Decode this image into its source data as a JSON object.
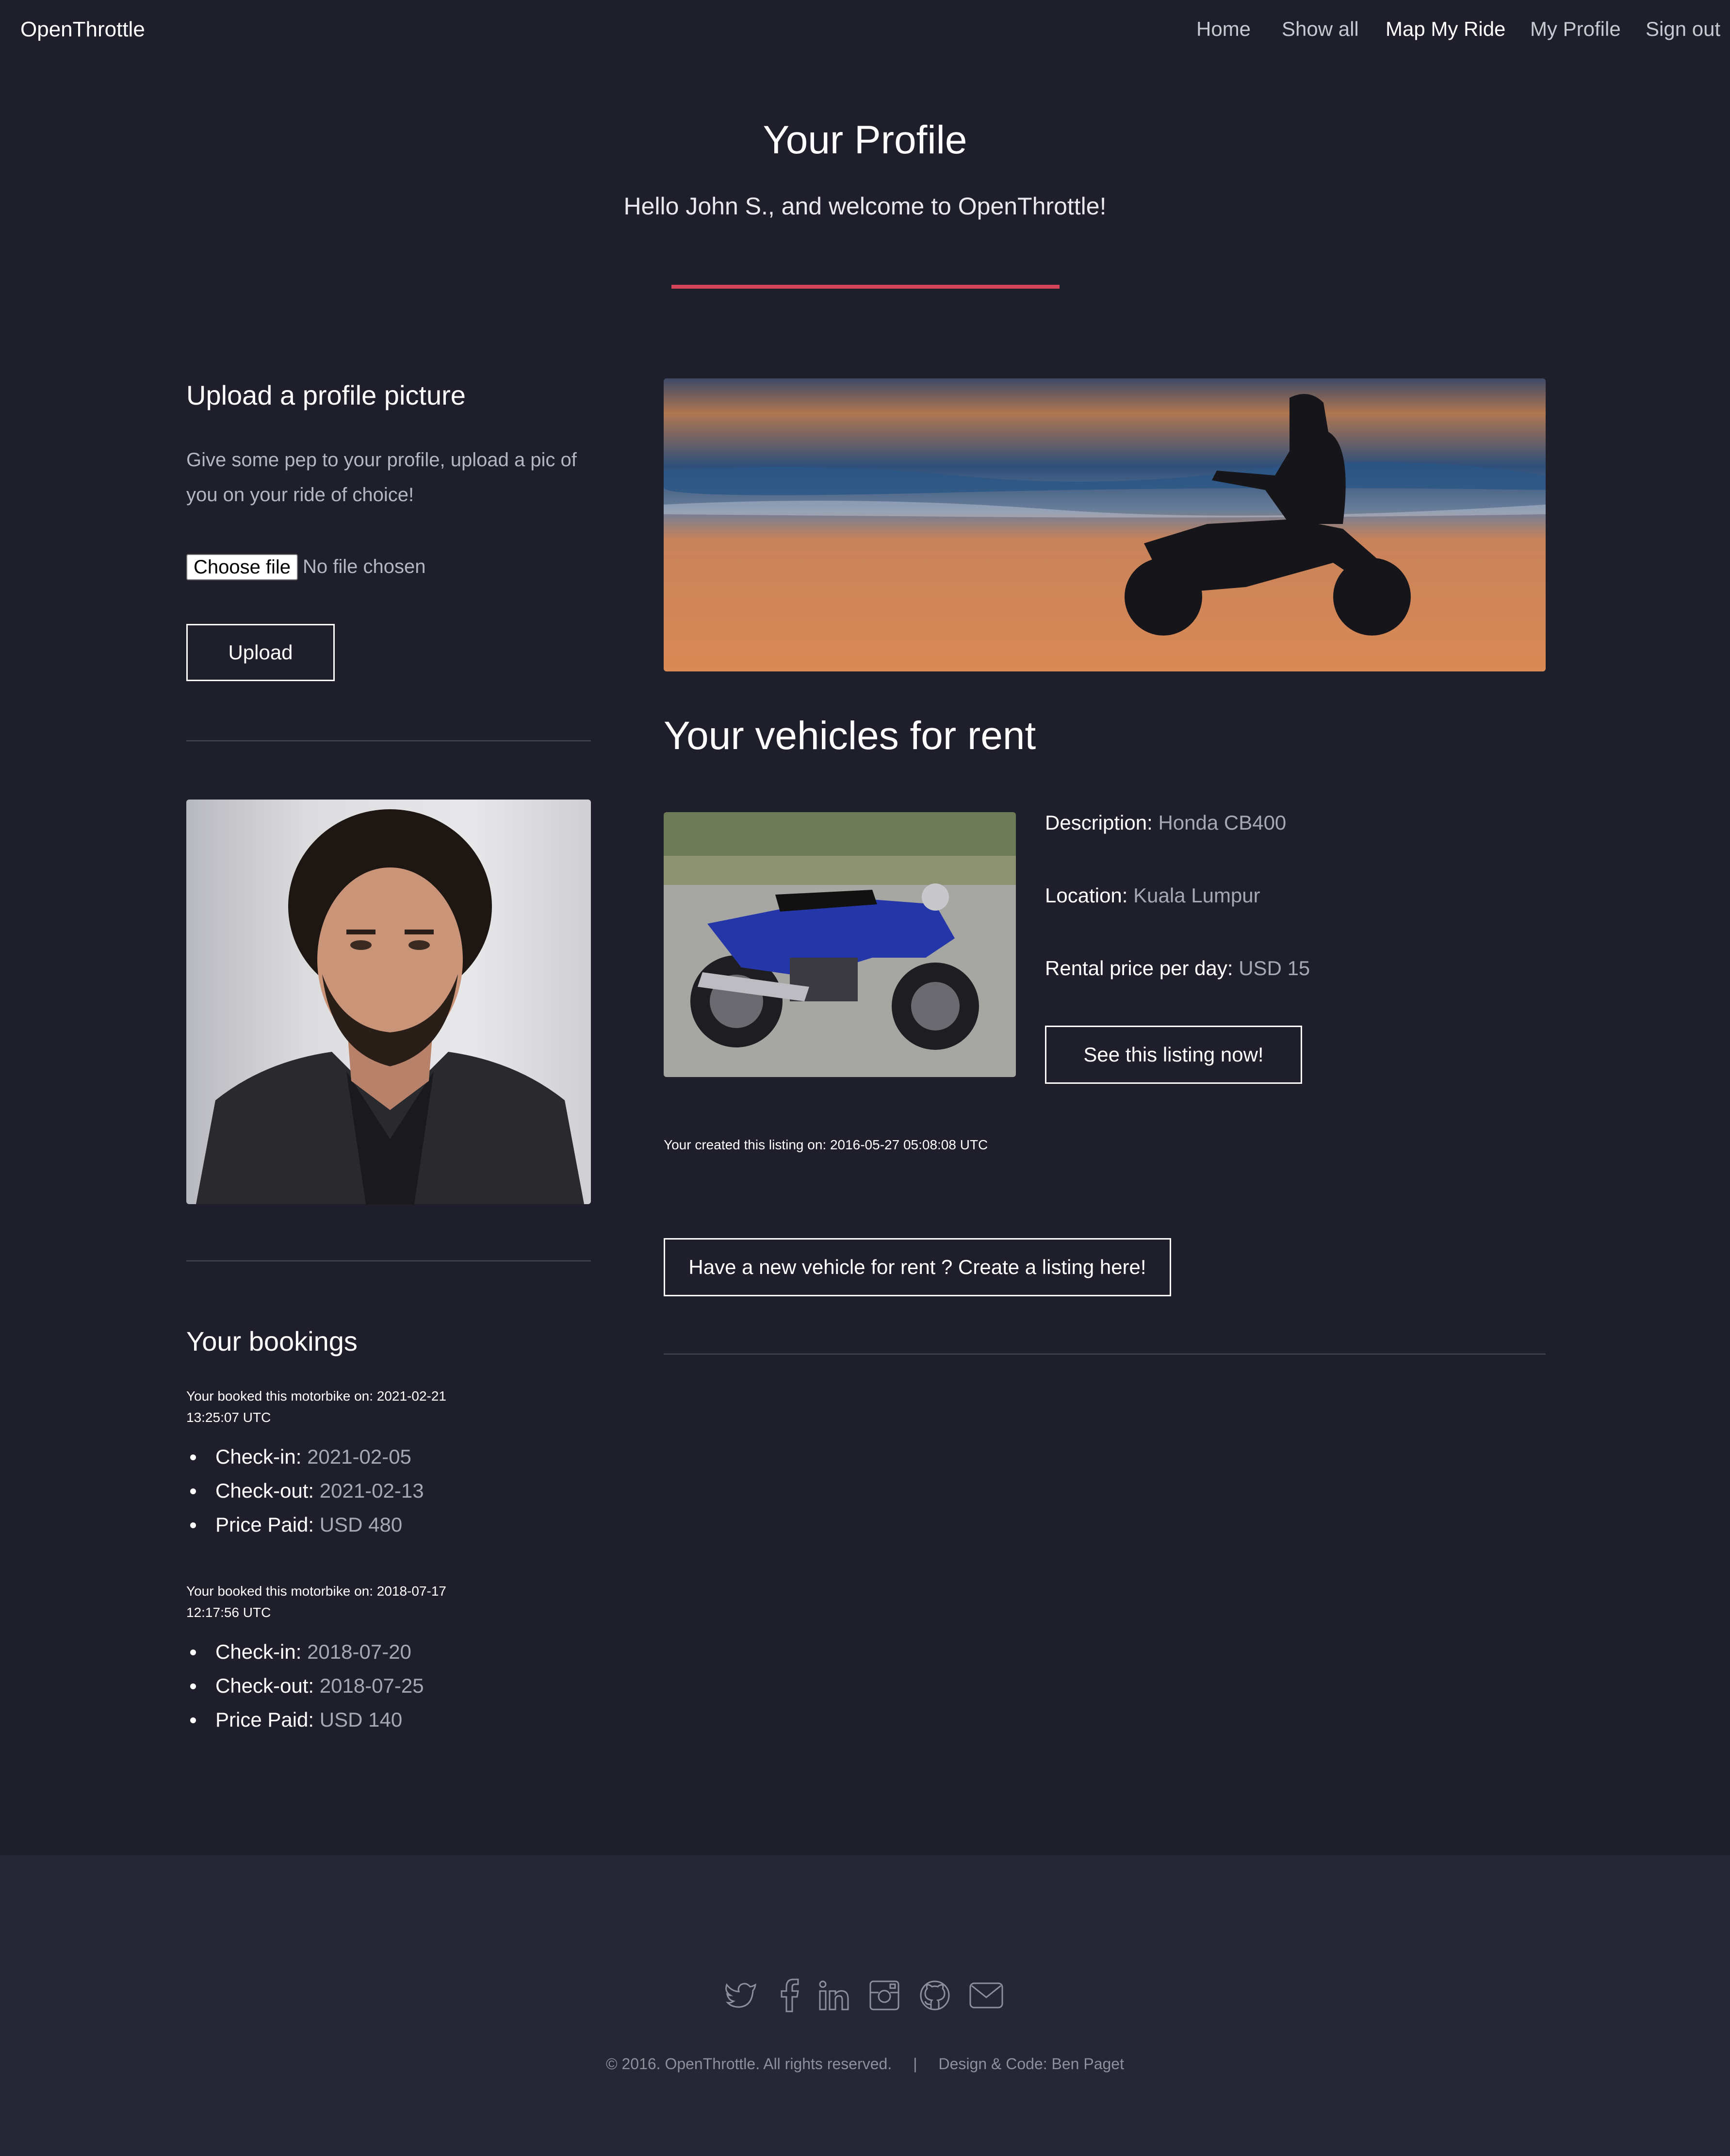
{
  "nav": {
    "brand": "OpenThrottle",
    "items": [
      "Home",
      "Show all",
      "Map My Ride",
      "My Profile",
      "Sign out"
    ]
  },
  "header": {
    "title": "Your Profile",
    "welcome": "Hello John S., and welcome to OpenThrottle!",
    "accent_color": "#d6445a"
  },
  "upload": {
    "heading": "Upload a profile picture",
    "description": "Give some pep to your profile, upload a pic of you on your ride of choice!",
    "choose_file_label": "Choose file",
    "file_status": "No file chosen",
    "upload_button": "Upload"
  },
  "bookings": {
    "heading": "Your bookings",
    "items": [
      {
        "booked_on": "Your booked this motorbike on: 2021-02-21 13:25:07 UTC",
        "checkin_label": "Check-in:",
        "checkin": "2021-02-05",
        "checkout_label": "Check-out:",
        "checkout": "2021-02-13",
        "price_label": "Price Paid:",
        "price": "USD 480"
      },
      {
        "booked_on": "Your booked this motorbike on: 2018-07-17 12:17:56 UTC",
        "checkin_label": "Check-in:",
        "checkin": "2018-07-20",
        "checkout_label": "Check-out:",
        "checkout": "2018-07-25",
        "price_label": "Price Paid:",
        "price": "USD 140"
      }
    ]
  },
  "vehicles": {
    "heading": "Your vehicles for rent",
    "listing": {
      "description_label": "Description:",
      "description": "Honda CB400",
      "location_label": "Location:",
      "location": "Kuala Lumpur",
      "price_label": "Rental price per day:",
      "price": "USD 15",
      "see_button": "See this listing now!",
      "created": "Your created this listing on: 2016-05-27 05:08:08 UTC"
    },
    "create_button": "Have a new vehicle for rent ? Create a listing here!"
  },
  "footer": {
    "social_icons": [
      "twitter-icon",
      "facebook-icon",
      "linkedin-icon",
      "instagram-icon",
      "github-icon",
      "mail-icon"
    ],
    "copyright": "© 2016. OpenThrottle. All rights reserved.",
    "separator": "|",
    "credit": "Design & Code: Ben Paget"
  }
}
